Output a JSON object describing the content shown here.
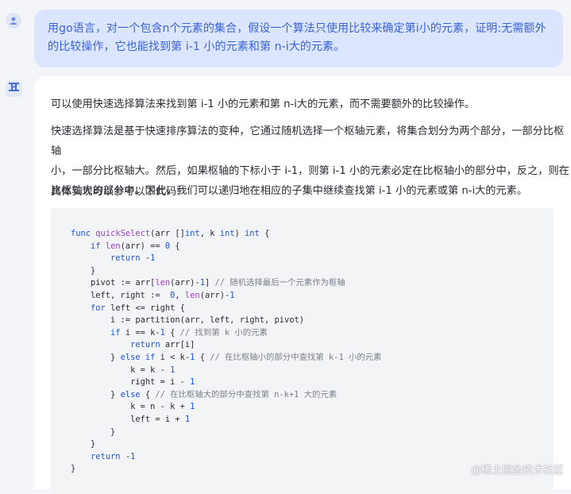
{
  "user_message": {
    "text": "用go语言，对一个包含n个元素的集合，假设一个算法只使用比较来确定第i小的元素，证明:无需额外\n的比较操作，它也能找到第 i-1 小的元素和第 n-i大的元素。"
  },
  "assistant": {
    "paragraphs": [
      "可以使用快速选择算法来找到第 i-1 小的元素和第 n-i大的元素，而不需要额外的比较操作。",
      "快速选择算法是基于快速排序算法的变种，它通过随机选择一个枢轴元素，将集合划分为两个部分，一部分比枢轴\n小，一部分比枢轴大。然后，如果枢轴的下标小于 i-1，则第 i-1 小的元素必定在比枢轴小的部分中，反之，则在\n比枢轴大的部分中。因此，我们可以递归地在相应的子集中继续查找第 i-1 小的元素或第 n-i大的元素。",
      "具体实现可以参考以下代码:"
    ],
    "code_lines": [
      "func quickSelect(arr []int, k int) int {",
      "    if len(arr) == 0 {",
      "        return -1",
      "    }",
      "    pivot := arr[len(arr)-1] // 随机选择最后一个元素作为枢轴",
      "    left, right :=  0, len(arr)-1",
      "    for left <= right {",
      "        i := partition(arr, left, right, pivot)",
      "        if i == k-1 { // 找到第 k 小的元素",
      "            return arr[i]",
      "        } else if i < k-1 { // 在比枢轴小的部分中查找第 k-1 小的元素",
      "            k = k - 1",
      "            right = i - 1",
      "        } else { // 在比枢轴大的部分中查找第 n-k+1 大的元素",
      "            k = n - k + 1",
      "            left = i + 1",
      "        }",
      "    }",
      "    return -1",
      "}"
    ]
  },
  "watermark": "@稀土掘金技术社区",
  "icons": {
    "user_avatar": "user-icon",
    "bot_avatar": "bot-logo-icon"
  }
}
